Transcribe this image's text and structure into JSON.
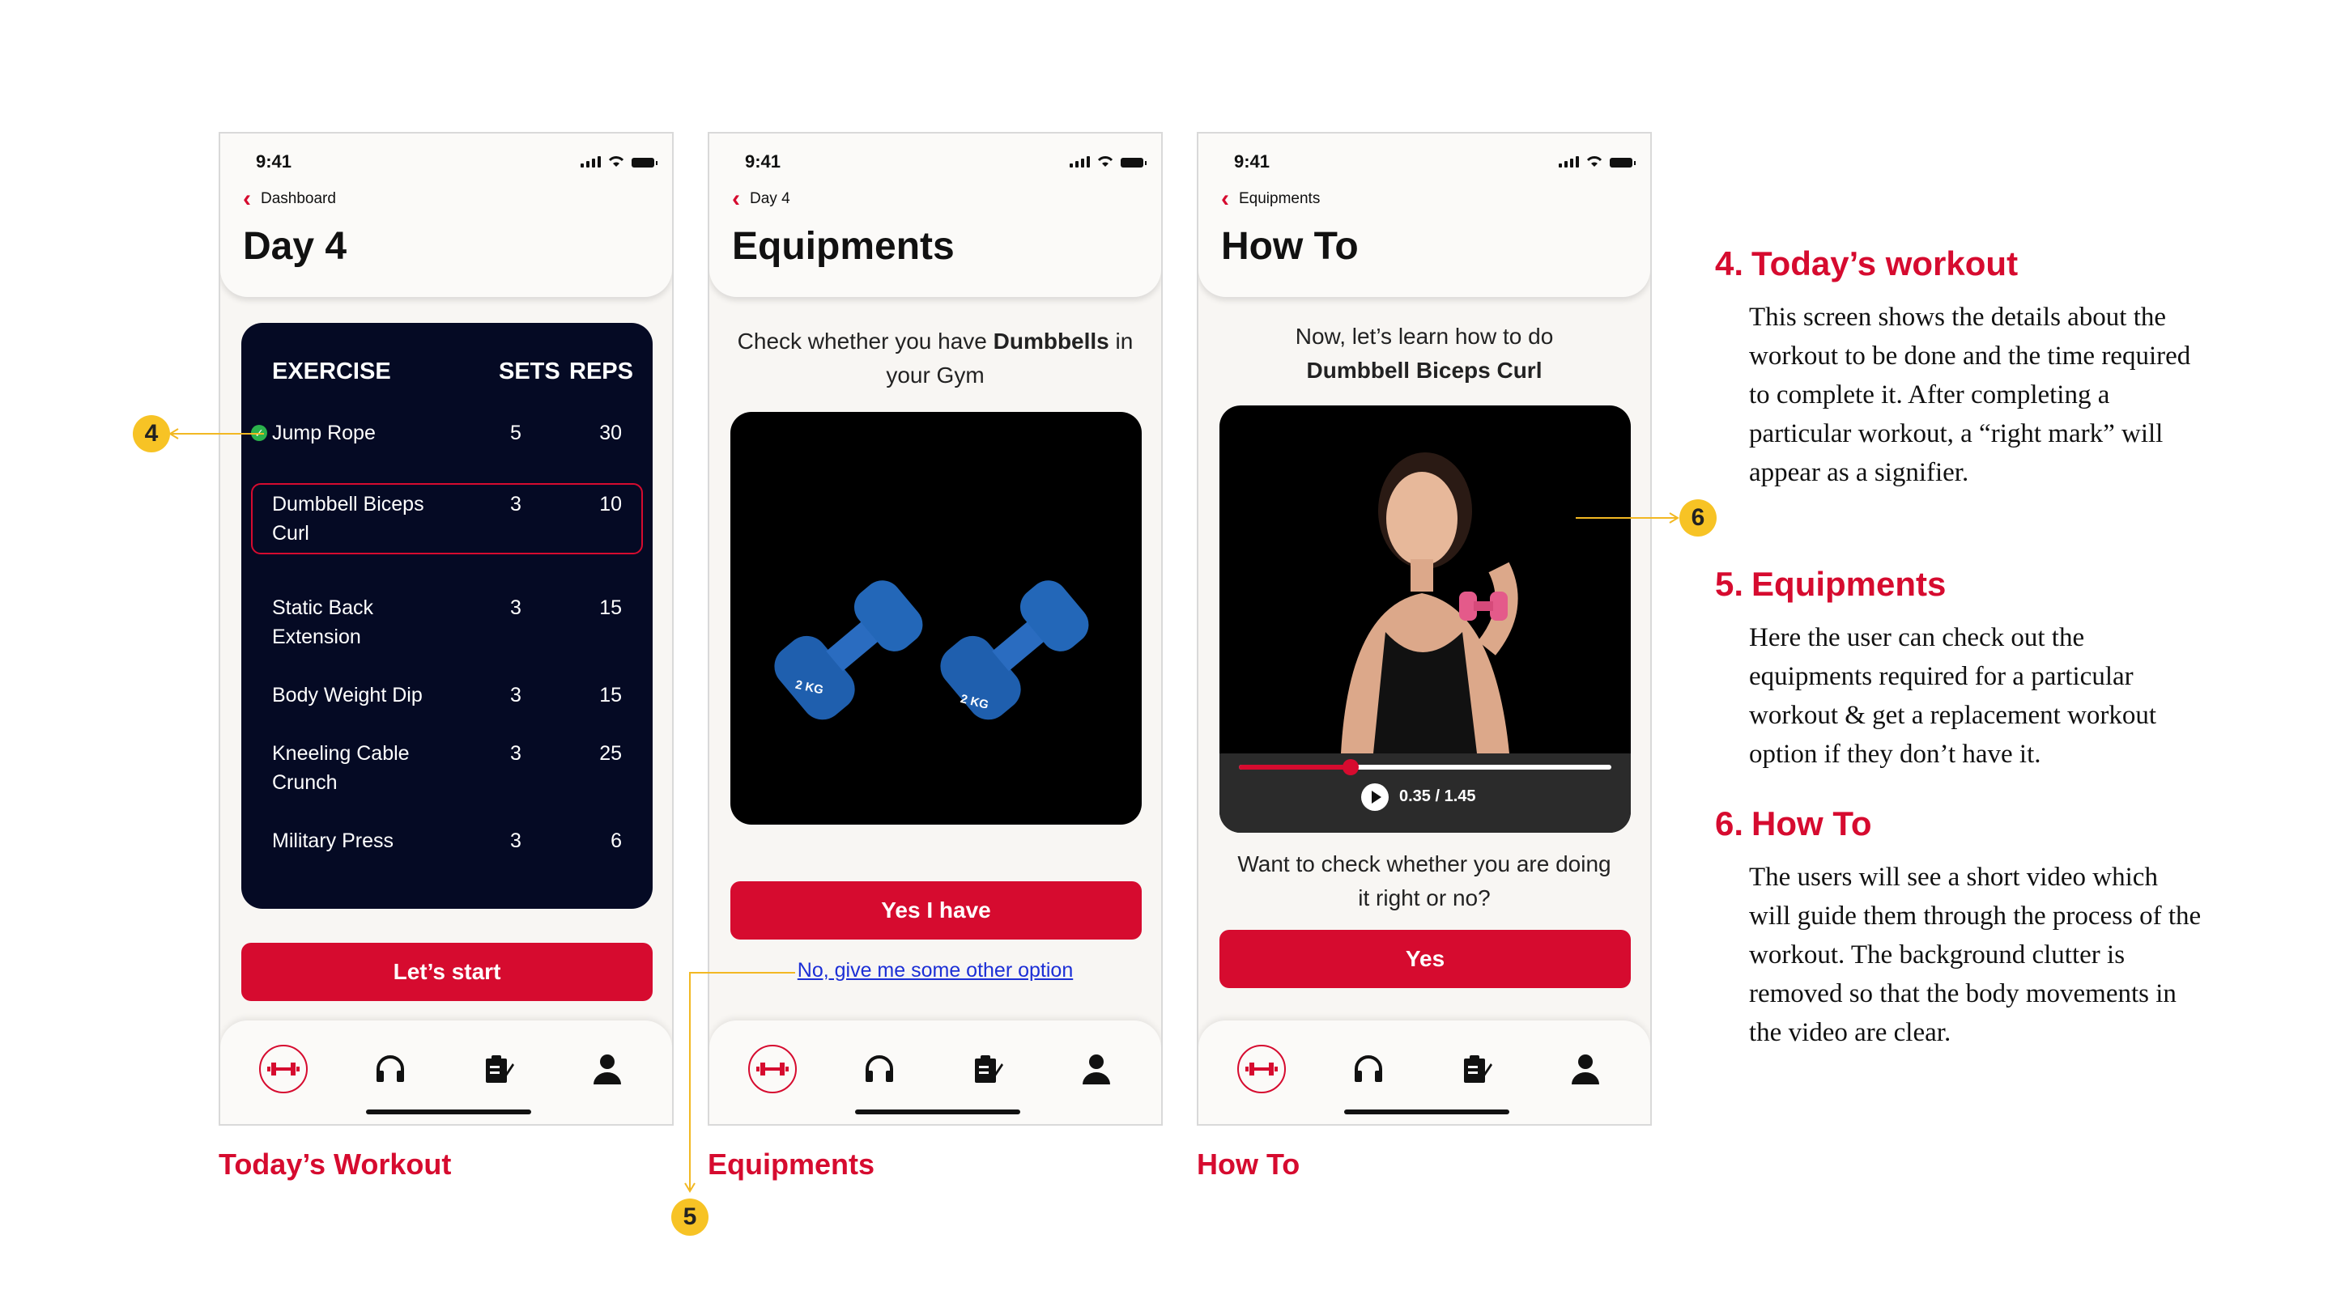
{
  "status_time": "9:41",
  "screens": {
    "workout": {
      "back_label": "Dashboard",
      "title": "Day 4",
      "headers": {
        "exercise": "EXERCISE",
        "sets": "SETS",
        "reps": "REPS"
      },
      "rows": [
        {
          "name": "Jump Rope",
          "sets": "5",
          "reps": "30",
          "done": true
        },
        {
          "name": "Dumbbell Biceps Curl",
          "sets": "3",
          "reps": "10",
          "highlighted": true
        },
        {
          "name": "Static Back Extension",
          "sets": "3",
          "reps": "15"
        },
        {
          "name": "Body Weight Dip",
          "sets": "3",
          "reps": "15"
        },
        {
          "name": "Kneeling Cable Crunch",
          "sets": "3",
          "reps": "25"
        },
        {
          "name": "Military Press",
          "sets": "3",
          "reps": "6"
        }
      ],
      "start_label": "Let’s start",
      "caption": "Today’s Workout"
    },
    "equipments": {
      "back_label": "Day 4",
      "title": "Equipments",
      "prompt_pre": "Check whether you have ",
      "prompt_bold": "Dumbbells",
      "prompt_post": " in your Gym",
      "dumbbell_mark": "2 KG",
      "yes_label": "Yes I have",
      "alt_link": "No, give me some other option",
      "caption": "Equipments"
    },
    "howto": {
      "back_label": "Equipments",
      "title": "How To",
      "intro": "Now, let’s learn how to do",
      "exercise": "Dumbbell Biceps Curl",
      "video_time": "0.35 / 1.45",
      "video_progress": 0.3,
      "question": "Want to check whether you are doing it right or no?",
      "yes_label": "Yes",
      "caption": "How To"
    }
  },
  "badges": {
    "b4": "4",
    "b5": "5",
    "b6": "6"
  },
  "notes": [
    {
      "num": "4.",
      "title": "Today’s workout",
      "body": "This screen shows the details about the workout to be done and the time required to complete it. After completing a particular workout, a “right mark” will appear as a signifier."
    },
    {
      "num": "5.",
      "title": "Equipments",
      "body": "Here the user can check out the equipments required for a particular workout & get a replacement workout option if they don’t have it."
    },
    {
      "num": "6.",
      "title": "How To",
      "body": "The users will see a short video which will guide them through the process of the workout. The background clutter is removed so that the body movements in the video are clear."
    }
  ],
  "colors": {
    "accent": "#d60b2f",
    "card": "#050a24",
    "badge": "#f7c325",
    "link": "#1c2fd6",
    "check": "#2bb24c"
  },
  "tab_icons": [
    "dumbbell-icon",
    "headphones-icon",
    "clipboard-icon",
    "profile-icon"
  ]
}
